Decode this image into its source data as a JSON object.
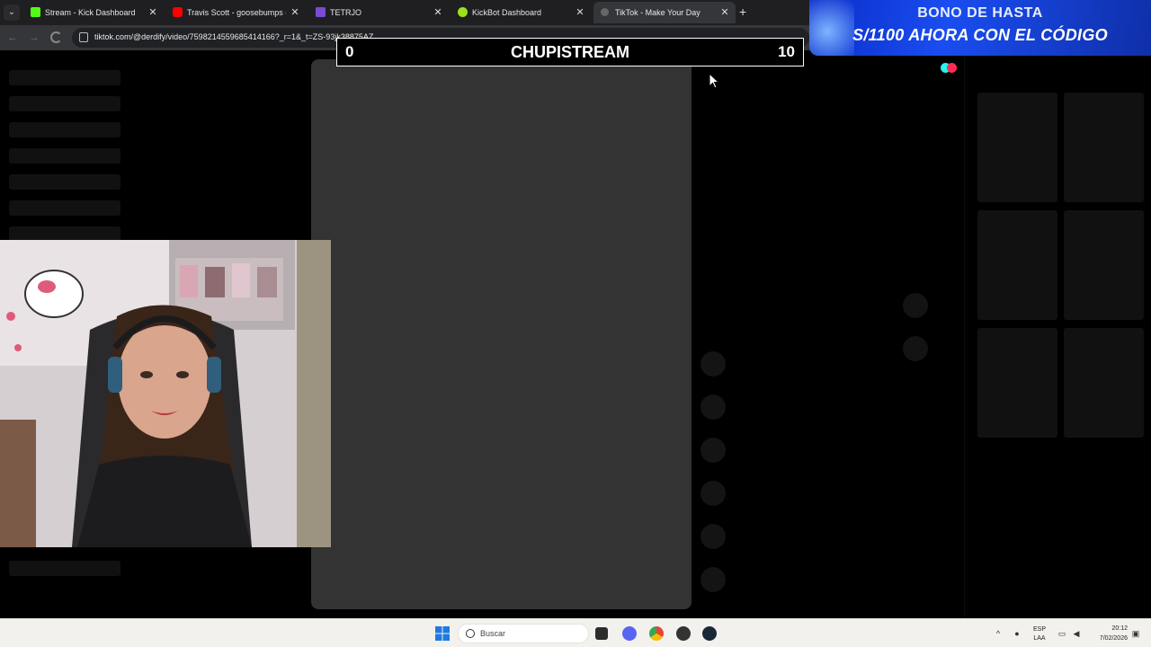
{
  "tabs": [
    {
      "title": "Stream - Kick Dashboard",
      "favicon": "kick-icon",
      "color": "#53fc18"
    },
    {
      "title": "Travis Scott - goosebumps (Offi",
      "favicon": "youtube-icon",
      "color": "#ff0000"
    },
    {
      "title": "TETRJO",
      "favicon": "tetrio-icon",
      "color": "#7b4bd6"
    },
    {
      "title": "KickBot Dashboard",
      "favicon": "kickbot-icon",
      "color": "#9be21b"
    },
    {
      "title": "TikTok - Make Your Day",
      "favicon": "tiktok-icon",
      "color": "#cccccc",
      "active": true
    }
  ],
  "address_bar": {
    "url": "tiktok.com/@derdify/video/7598214559685414166?_r=1&_t=ZS-93jk38875AZ"
  },
  "scoreboard": {
    "left_score": "0",
    "title": "CHUPISTREAM",
    "right_score": "10"
  },
  "promo": {
    "line1": "BONO DE HASTA",
    "line2": "S/1100 AHORA CON EL CÓDIGO"
  },
  "taskbar": {
    "search_label": "Buscar",
    "lang_top": "ESP",
    "lang_bottom": "LAA",
    "time": "20:12",
    "date": "7/02/2026"
  },
  "colors": {
    "tiktok_cyan": "#25f4ee",
    "tiktok_red": "#fe2c55",
    "promo_blue": "#1a4df0"
  }
}
